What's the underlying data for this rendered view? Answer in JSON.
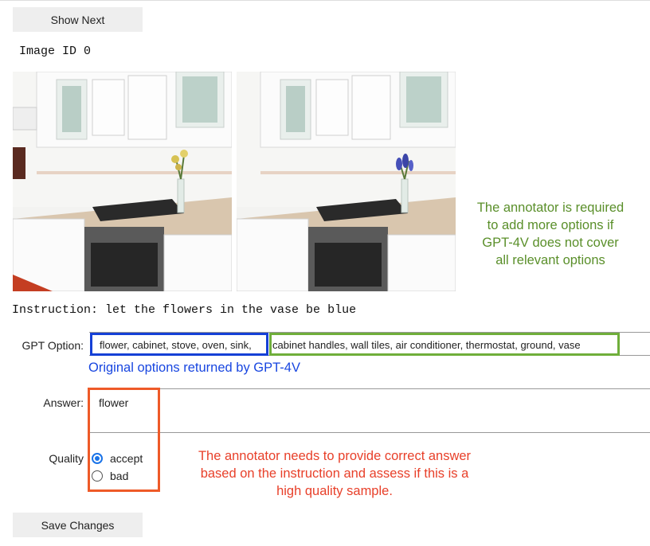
{
  "buttons": {
    "show_next": "Show Next",
    "save_changes": "Save Changes"
  },
  "image_id": "Image ID 0",
  "instruction": "Instruction: let the flowers in the vase be blue",
  "gpt_option": {
    "label": "GPT Option:",
    "original_text": "flower, cabinet, stove, oven, sink,",
    "added_text": "cabinet handles, wall tiles, air conditioner, thermostat, ground, vase"
  },
  "annotations": {
    "blue": "Original options returned by GPT-4V",
    "green": "The annotator is required to add more options if GPT-4V does not cover all relevant options",
    "red": "The annotator needs to provide correct answer based on the instruction and assess if this is a high quality sample."
  },
  "answer": {
    "label": "Answer:",
    "value": "flower"
  },
  "quality": {
    "label": "Quality",
    "options": [
      "accept",
      "bad"
    ],
    "selected": "accept"
  },
  "images": [
    {
      "name": "kitchen-original",
      "flowers": "yellow"
    },
    {
      "name": "kitchen-edited",
      "flowers": "blue"
    }
  ],
  "colors": {
    "blue_box": "#1540d6",
    "green_box": "#6fae3a",
    "red_box": "#ee5a28",
    "green_text": "#5a8f2a",
    "red_text": "#e8402a",
    "blue_text": "#1846e0"
  }
}
